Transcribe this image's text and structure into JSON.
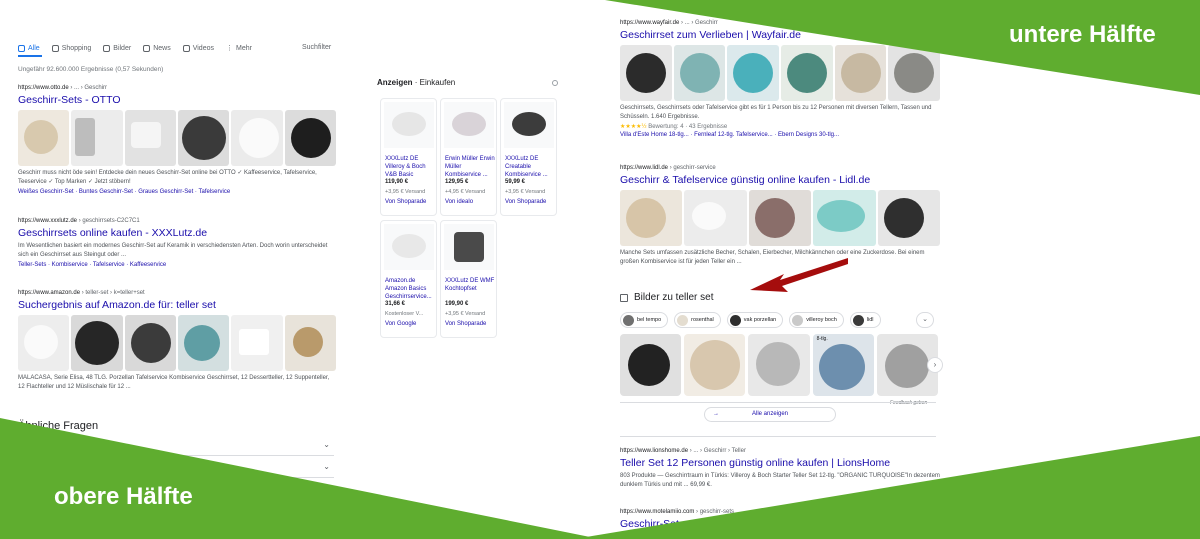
{
  "colors": {
    "green": "#5fad2f",
    "link": "#1a0dab",
    "accent": "#1a73e8",
    "arrow": "#a50d0d"
  },
  "overlay": {
    "top_label": "untere Hälfte",
    "bottom_label": "obere Hälfte"
  },
  "left": {
    "tabs": [
      {
        "label": "Alle",
        "icon": "search-icon"
      },
      {
        "label": "Shopping",
        "icon": "tag-icon"
      },
      {
        "label": "Bilder",
        "icon": "image-icon"
      },
      {
        "label": "News",
        "icon": "news-icon"
      },
      {
        "label": "Videos",
        "icon": "video-icon"
      },
      {
        "label": "Mehr",
        "icon": "more-icon"
      }
    ],
    "tools_label": "Suchfilter",
    "result_count": "Ungefähr 92.600.000 Ergebnisse (0,57 Sekunden)",
    "results": [
      {
        "url": "https://www.otto.de",
        "crumb": " › ... › Geschirr",
        "title": "Geschirr-Sets - OTTO",
        "snippet": "Geschirr muss nicht öde sein! Entdecke dein neues Geschirr-Set online bei OTTO ✓ Kaffeeservice, Tafelservice, Teeservice ✓ Top Marken ✓ Jetzt stöbern!",
        "links": "Weißes Geschirr-Set · Buntes Geschirr-Set · Graues Geschirr-Set · Tafelservice"
      },
      {
        "url": "https://www.xxxlutz.de",
        "crumb": " › geschirrsets-C2C7C1",
        "title": "Geschirrsets online kaufen - XXXLutz.de",
        "snippet": "Im Wesentlichen basiert ein modernes Geschirr-Set auf Keramik in verschiedensten Arten. Doch worin unterscheidet sich ein Geschirrset aus Steingut oder ...",
        "links": "Teller-Sets · Kombiservice · Tafelservice · Kaffeeservice"
      },
      {
        "url": "https://www.amazon.de",
        "crumb": " › teller-set › k=teller+set",
        "title": "Suchergebnis auf Amazon.de für: teller set",
        "snippet": "MALACASA, Serie Elisa, 48 TLG. Porzellan Tafelservice Kombiservice Geschirrset, 12 Dessertteller, 12 Suppenteller, 12 Flachteller und 12 Müslischale für 12 ..."
      }
    ],
    "faq_title": "Ähnliche Fragen"
  },
  "shopping": {
    "head_bold": "Anzeigen",
    "head_rest": " · Einkaufen",
    "products": [
      {
        "title": "XXXLutz DE Villeroy & Boch V&B Basic",
        "price": "119,90 €",
        "ship": "+3,95 € Versand",
        "store": "Von Shoparade"
      },
      {
        "title": "Erwin Müller Erwin Müller Kombiservice ...",
        "price": "129,95 €",
        "ship": "+4,95 € Versand",
        "store": "Von idealo"
      },
      {
        "title": "XXXLutz DE Creatable Kombiservice ...",
        "price": "59,99 €",
        "ship": "+3,95 € Versand",
        "store": "Von Shoparade"
      },
      {
        "title": "Amazon.de Amazon Basics Geschirrservice...",
        "price": "31,66 €",
        "ship": "Kostenloser V...",
        "store": "Von Google"
      },
      {
        "title": "XXXLutz DE WMF Kochtopfset",
        "price": "199,90 €",
        "ship": "+3,95 € Versand",
        "store": "Von Shoparade"
      }
    ]
  },
  "right": {
    "results": [
      {
        "url": "https://www.wayfair.de",
        "crumb": " › ... › Geschirr",
        "title": "Geschirrset zum Verlieben | Wayfair.de",
        "snippet": "Geschirrsets, Geschirrsets oder Tafelservice gibt es für 1 Person bis zu 12 Personen mit diversen Tellern, Tassen und Schüsseln. 1.640 Ergebnisse.",
        "stars": "★★★★½",
        "rating": " Bewertung: 4 · 43 Ergebnisse",
        "links": "Villa d'Este Home 18-tlg... · Fernleaf 12-tlg. Tafelservice... · Ebern Designs 30-tlg..."
      },
      {
        "url": "https://www.lidl.de",
        "crumb": " › geschirr-service",
        "title": "Geschirr & Tafelservice günstig online kaufen - Lidl.de",
        "snippet": "Manche Sets umfassen zusätzliche Becher, Schalen, Eierbecher, Milchkännchen oder eine Zuckerdose. Bei einem großen Kombiservice ist für jeden Teller ein ..."
      }
    ],
    "images_title": "Bilder zu teller set",
    "chips": [
      {
        "label": "bel tempo",
        "color": "#707070"
      },
      {
        "label": "rosenthal",
        "color": "#e4ddd0"
      },
      {
        "label": "vak porzellan",
        "color": "#2e2e2e"
      },
      {
        "label": "villeroy boch",
        "color": "#c9c9c9"
      },
      {
        "label": "lidl",
        "color": "#3a3a3a"
      }
    ],
    "image_badge": "8-tlg.",
    "feedback": "Feedback geben",
    "show_all": "Alle anzeigen",
    "bottom_results": [
      {
        "url": "https://www.lionshome.de",
        "crumb": " › ... › Geschirr › Teller",
        "title": "Teller Set 12 Personen günstig online kaufen | LionsHome",
        "snippet": "803 Produkte — Geschirrtraum in Türkis: Villeroy & Boch Starter Teller Set 12-tlg. \"ORGANIC TURQUOISE\"In dezentem dunklem Türkis und mit ... 69,99 €."
      },
      {
        "url": "https://www.motelamiio.com",
        "crumb": " › geschirr-sets",
        "title": "Geschirr-Sets • Motel a Miio • POTTERY LOVE"
      }
    ]
  }
}
